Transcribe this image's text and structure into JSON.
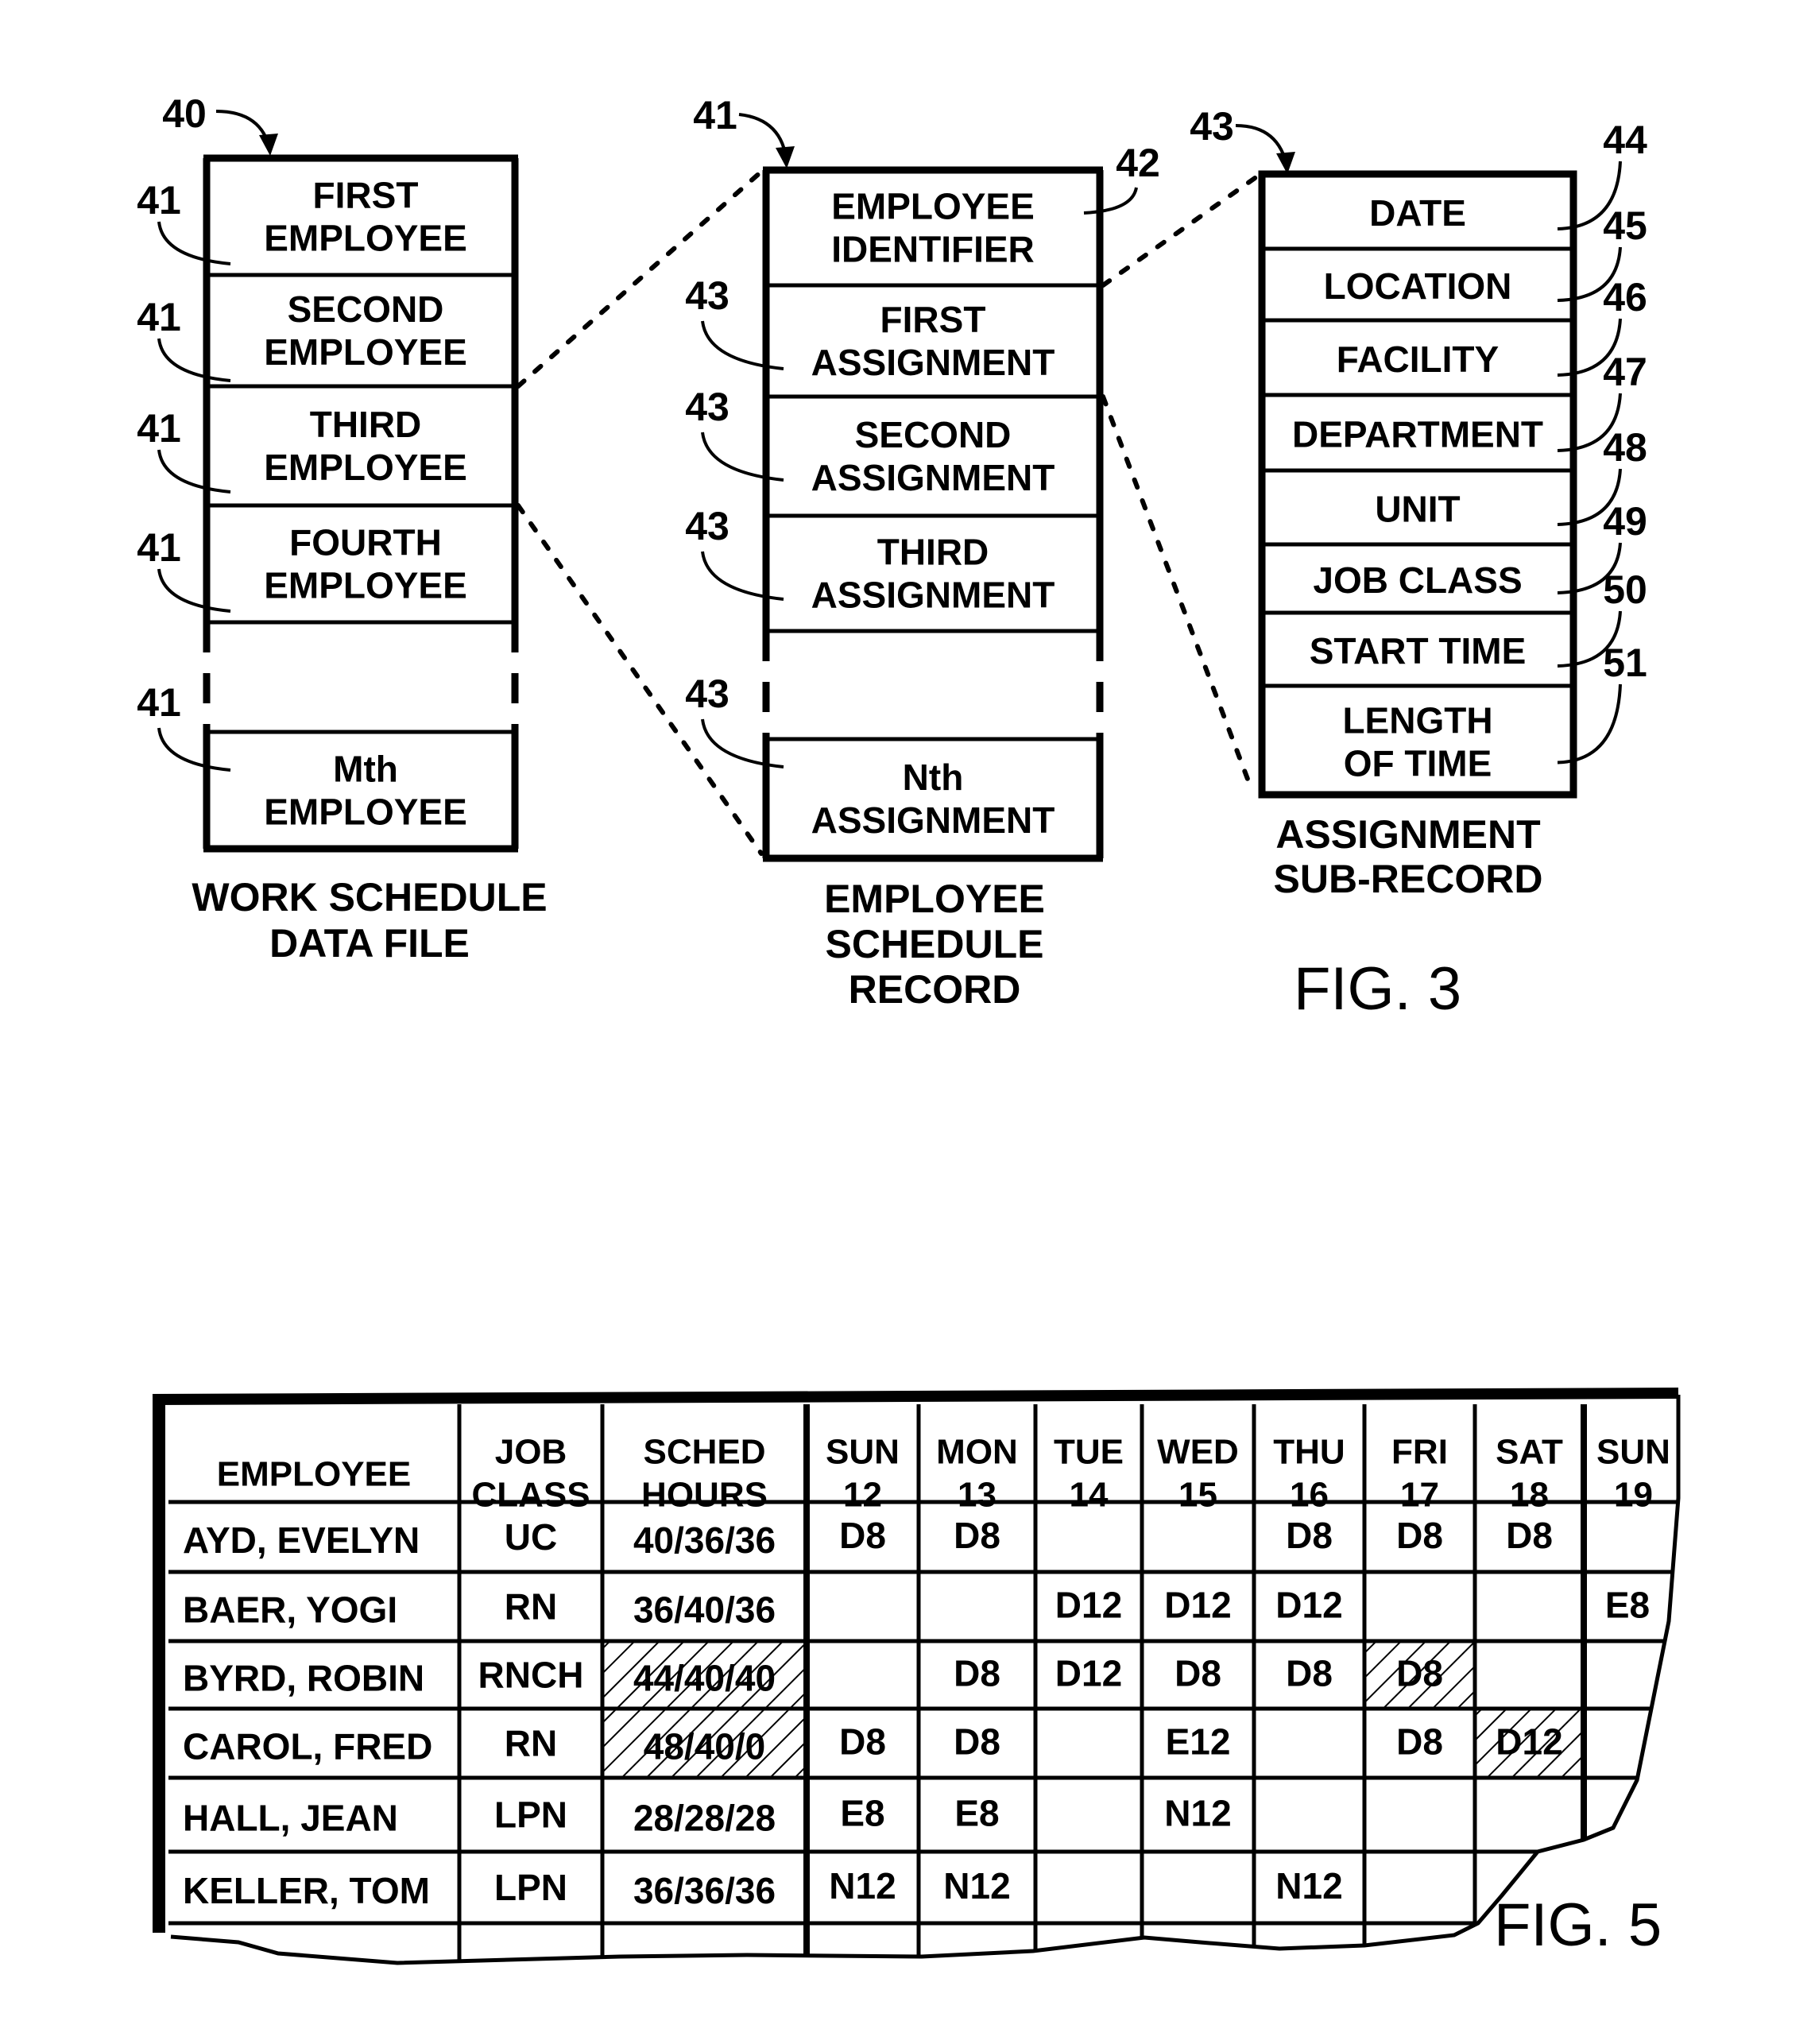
{
  "fig3": {
    "title": "FIG. 3",
    "data_file": {
      "ref": "40",
      "caption": [
        "WORK SCHEDULE",
        "DATA FILE"
      ],
      "item_ref": "41",
      "rows": [
        [
          "FIRST",
          "EMPLOYEE"
        ],
        [
          "SECOND",
          "EMPLOYEE"
        ],
        [
          "THIRD",
          "EMPLOYEE"
        ],
        [
          "FOURTH",
          "EMPLOYEE"
        ],
        [
          "",
          ""
        ],
        [
          "Mth",
          "EMPLOYEE"
        ]
      ]
    },
    "schedule_record": {
      "ref": "41",
      "caption": [
        "EMPLOYEE",
        "SCHEDULE",
        "RECORD"
      ],
      "identifier_ref": "42",
      "item_ref": "43",
      "rows": [
        [
          "EMPLOYEE",
          "IDENTIFIER"
        ],
        [
          "FIRST",
          "ASSIGNMENT"
        ],
        [
          "SECOND",
          "ASSIGNMENT"
        ],
        [
          "THIRD",
          "ASSIGNMENT"
        ],
        [
          "",
          ""
        ],
        [
          "Nth",
          "ASSIGNMENT"
        ]
      ]
    },
    "sub_record": {
      "ref": "43",
      "caption": [
        "ASSIGNMENT",
        "SUB-RECORD"
      ],
      "rows": [
        {
          "label": [
            "DATE"
          ],
          "ref": "44"
        },
        {
          "label": [
            "LOCATION"
          ],
          "ref": "45"
        },
        {
          "label": [
            "FACILITY"
          ],
          "ref": "46"
        },
        {
          "label": [
            "DEPARTMENT"
          ],
          "ref": "47"
        },
        {
          "label": [
            "UNIT"
          ],
          "ref": "48"
        },
        {
          "label": [
            "JOB CLASS"
          ],
          "ref": "49"
        },
        {
          "label": [
            "START TIME"
          ],
          "ref": "50"
        },
        {
          "label": [
            "LENGTH",
            "OF TIME"
          ],
          "ref": "51"
        }
      ]
    }
  },
  "fig5": {
    "title": "FIG. 5",
    "columns": [
      [
        "EMPLOYEE"
      ],
      [
        "JOB",
        "CLASS"
      ],
      [
        "SCHED",
        "HOURS"
      ],
      [
        "SUN",
        "12"
      ],
      [
        "MON",
        "13"
      ],
      [
        "TUE",
        "14"
      ],
      [
        "WED",
        "15"
      ],
      [
        "THU",
        "16"
      ],
      [
        "FRI",
        "17"
      ],
      [
        "SAT",
        "18"
      ],
      [
        "SUN",
        "19"
      ]
    ],
    "rows": [
      {
        "employee": "AYD, EVELYN",
        "job_class": "UC",
        "sched_hours": "40/36/36",
        "hours_flagged": false,
        "days": [
          "D8",
          "D8",
          "",
          "",
          "D8",
          "D8",
          "D8",
          ""
        ],
        "flagged_days": []
      },
      {
        "employee": "BAER, YOGI",
        "job_class": "RN",
        "sched_hours": "36/40/36",
        "hours_flagged": false,
        "days": [
          "",
          "",
          "D12",
          "D12",
          "D12",
          "",
          "",
          "E8"
        ],
        "flagged_days": []
      },
      {
        "employee": "BYRD, ROBIN",
        "job_class": "RNCH",
        "sched_hours": "44/40/40",
        "hours_flagged": true,
        "days": [
          "",
          "D8",
          "D12",
          "D8",
          "D8",
          "D8",
          "",
          ""
        ],
        "flagged_days": [
          5
        ]
      },
      {
        "employee": "CAROL, FRED",
        "job_class": "RN",
        "sched_hours": "48/40/0",
        "hours_flagged": true,
        "days": [
          "D8",
          "D8",
          "",
          "E12",
          "",
          "D8",
          "D12",
          ""
        ],
        "flagged_days": [
          6
        ]
      },
      {
        "employee": "HALL, JEAN",
        "job_class": "LPN",
        "sched_hours": "28/28/28",
        "hours_flagged": false,
        "days": [
          "E8",
          "E8",
          "",
          "N12",
          "",
          "",
          "",
          ""
        ],
        "flagged_days": []
      },
      {
        "employee": "KELLER, TOM",
        "job_class": "LPN",
        "sched_hours": "36/36/36",
        "hours_flagged": false,
        "days": [
          "N12",
          "N12",
          "",
          "",
          "N12",
          "",
          "",
          ""
        ],
        "flagged_days": []
      }
    ]
  }
}
